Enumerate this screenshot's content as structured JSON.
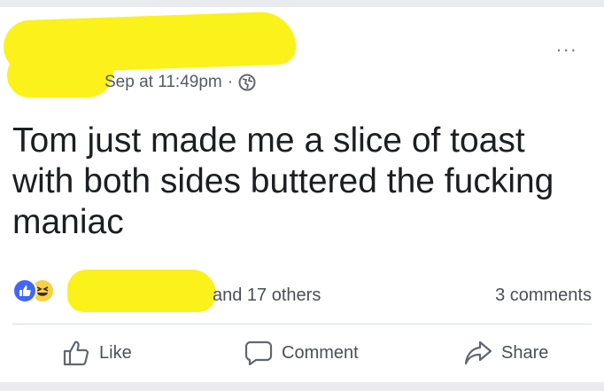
{
  "post": {
    "timestamp": "Sep at 11:49pm",
    "separator": "·",
    "privacy_icon": "globe-icon",
    "more_icon": "more-options-icon",
    "more_label": "...",
    "text": "Tom just made me a slice of toast with both sides buttered the fucking maniac"
  },
  "reactions": {
    "icons": [
      "like-reaction-icon",
      "haha-reaction-icon"
    ],
    "others_text": "and 17 others",
    "comments_text": "3 comments"
  },
  "actions": {
    "like_label": "Like",
    "comment_label": "Comment",
    "share_label": "Share"
  },
  "colors": {
    "redaction": "#fbf11b",
    "like_blue": "#4267f5",
    "haha_yellow": "#f7d046",
    "text": "#1c1e21",
    "muted": "#4b4f56"
  }
}
